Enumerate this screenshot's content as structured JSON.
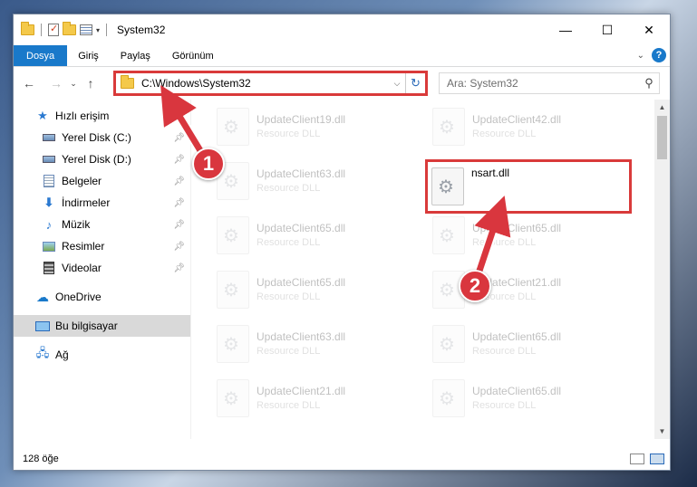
{
  "window": {
    "title": "System32",
    "controls": {
      "minimize": "—",
      "maximize": "☐",
      "close": "✕"
    }
  },
  "ribbon": {
    "tabs": [
      "Dosya",
      "Giriş",
      "Paylaş",
      "Görünüm"
    ],
    "collapse_icon": "chevron-down-icon",
    "help_label": "?"
  },
  "nav": {
    "back": "←",
    "forward": "→",
    "recent": "⌄",
    "up": "↑",
    "address": "C:\\Windows\\System32",
    "search_placeholder": "Ara: System32"
  },
  "sidebar": {
    "quick_access": "Hızlı erişim",
    "items": [
      {
        "label": "Yerel Disk (C:)",
        "icon": "disk-icon"
      },
      {
        "label": "Yerel Disk (D:)",
        "icon": "disk-icon"
      },
      {
        "label": "Belgeler",
        "icon": "documents-icon"
      },
      {
        "label": "İndirmeler",
        "icon": "downloads-icon"
      },
      {
        "label": "Müzik",
        "icon": "music-icon"
      },
      {
        "label": "Resimler",
        "icon": "pictures-icon"
      },
      {
        "label": "Videolar",
        "icon": "videos-icon"
      }
    ],
    "onedrive": "OneDrive",
    "this_pc": "Bu bilgisayar",
    "network": "Ağ"
  },
  "files": {
    "col1": [
      {
        "name": "UpdateClient19.dll",
        "type": "Resource DLL"
      },
      {
        "name": "UpdateClient63.dll",
        "type": "Resource DLL"
      },
      {
        "name": "UpdateClient65.dll",
        "type": "Resource DLL"
      },
      {
        "name": "UpdateClient65.dll",
        "type": "Resource DLL"
      },
      {
        "name": "UpdateClient63.dll",
        "type": "Resource DLL"
      },
      {
        "name": "UpdateClient21.dll",
        "type": "Resource DLL"
      }
    ],
    "col2": [
      {
        "name": "UpdateClient42.dll",
        "type": "Resource DLL"
      },
      {
        "name": "nsart.dll",
        "type": ""
      },
      {
        "name": "UpdateClient65.dll",
        "type": "Resource DLL"
      },
      {
        "name": "UpdateClient21.dll",
        "type": "Resource DLL"
      },
      {
        "name": "UpdateClient65.dll",
        "type": "Resource DLL"
      },
      {
        "name": "UpdateClient65.dll",
        "type": "Resource DLL"
      }
    ]
  },
  "status": {
    "item_count": "128 öğe"
  },
  "annotations": {
    "step1": "1",
    "step2": "2",
    "color": "#d9363e"
  }
}
